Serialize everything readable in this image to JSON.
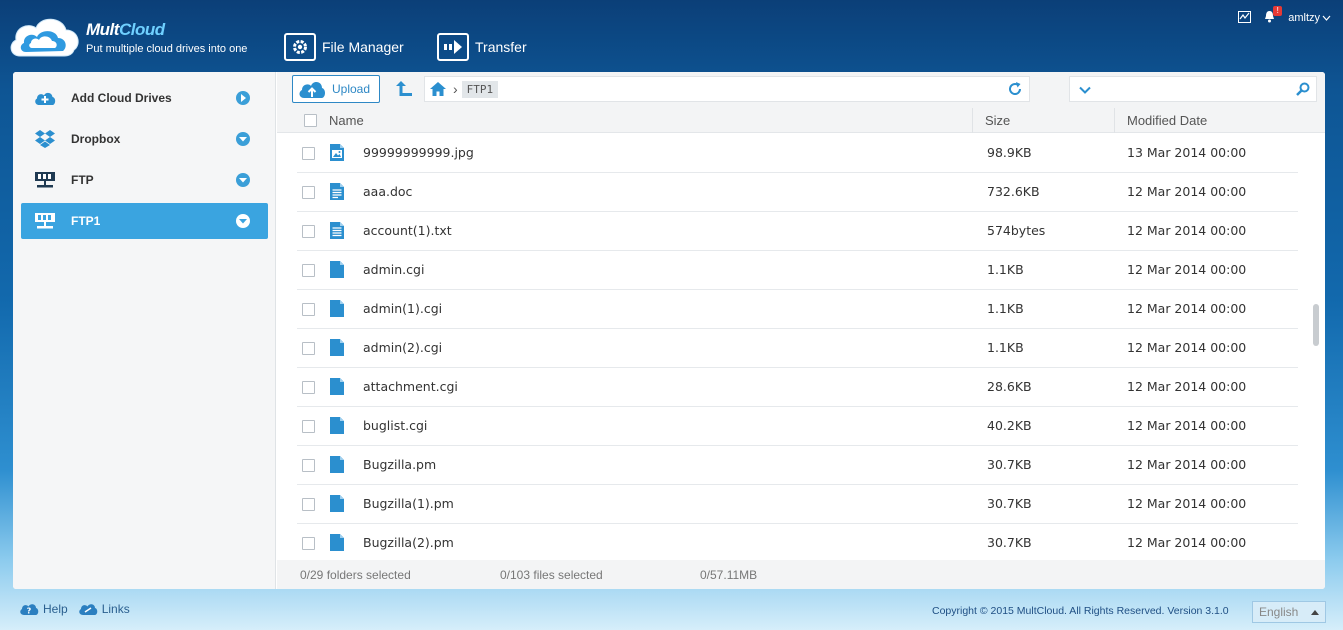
{
  "header": {
    "brand_part1": "Mult",
    "brand_part2": "Cloud",
    "tagline": "Put multiple cloud drives into one",
    "nav": [
      {
        "label": "File Manager",
        "icon": "gear-icon"
      },
      {
        "label": "Transfer",
        "icon": "transfer-arrow-icon"
      }
    ],
    "notification_badge": "!",
    "username": "amltzy"
  },
  "sidebar": {
    "items": [
      {
        "label": "Add Cloud Drives",
        "icon": "add-cloud-icon",
        "active": false
      },
      {
        "label": "Dropbox",
        "icon": "dropbox-icon",
        "active": false
      },
      {
        "label": "FTP",
        "icon": "ftp-server-icon",
        "active": false
      },
      {
        "label": "FTP1",
        "icon": "ftp-server-icon",
        "active": true
      }
    ]
  },
  "toolbar": {
    "upload_label": "Upload",
    "breadcrumb": [
      "FTP1"
    ],
    "search_placeholder": ""
  },
  "table": {
    "columns": [
      "Name",
      "Size",
      "Modified Date"
    ],
    "rows": [
      {
        "name": "99999999999.jpg",
        "size": "98.9KB",
        "date": "13 Mar 2014 00:00",
        "icon": "image-file-icon"
      },
      {
        "name": "aaa.doc",
        "size": "732.6KB",
        "date": "12 Mar 2014 00:00",
        "icon": "document-file-icon"
      },
      {
        "name": "account(1).txt",
        "size": "574bytes",
        "date": "12 Mar 2014 00:00",
        "icon": "text-file-icon"
      },
      {
        "name": "admin.cgi",
        "size": "1.1KB",
        "date": "12 Mar 2014 00:00",
        "icon": "generic-file-icon"
      },
      {
        "name": "admin(1).cgi",
        "size": "1.1KB",
        "date": "12 Mar 2014 00:00",
        "icon": "generic-file-icon"
      },
      {
        "name": "admin(2).cgi",
        "size": "1.1KB",
        "date": "12 Mar 2014 00:00",
        "icon": "generic-file-icon"
      },
      {
        "name": "attachment.cgi",
        "size": "28.6KB",
        "date": "12 Mar 2014 00:00",
        "icon": "generic-file-icon"
      },
      {
        "name": "buglist.cgi",
        "size": "40.2KB",
        "date": "12 Mar 2014 00:00",
        "icon": "generic-file-icon"
      },
      {
        "name": "Bugzilla.pm",
        "size": "30.7KB",
        "date": "12 Mar 2014 00:00",
        "icon": "generic-file-icon"
      },
      {
        "name": "Bugzilla(1).pm",
        "size": "30.7KB",
        "date": "12 Mar 2014 00:00",
        "icon": "generic-file-icon"
      },
      {
        "name": "Bugzilla(2).pm",
        "size": "30.7KB",
        "date": "12 Mar 2014 00:00",
        "icon": "generic-file-icon"
      }
    ]
  },
  "status": {
    "folders": "0/29 folders selected",
    "files": "0/103 files selected",
    "size": "0/57.11MB"
  },
  "footer": {
    "help": "Help",
    "links": "Links",
    "copyright": "Copyright © 2015 MultCloud. All Rights Reserved. Version 3.1.0",
    "language": "English"
  },
  "colors": {
    "accent": "#3aa4e0",
    "icon_blue": "#2b8fcf",
    "header_dark": "#0b3f78"
  }
}
